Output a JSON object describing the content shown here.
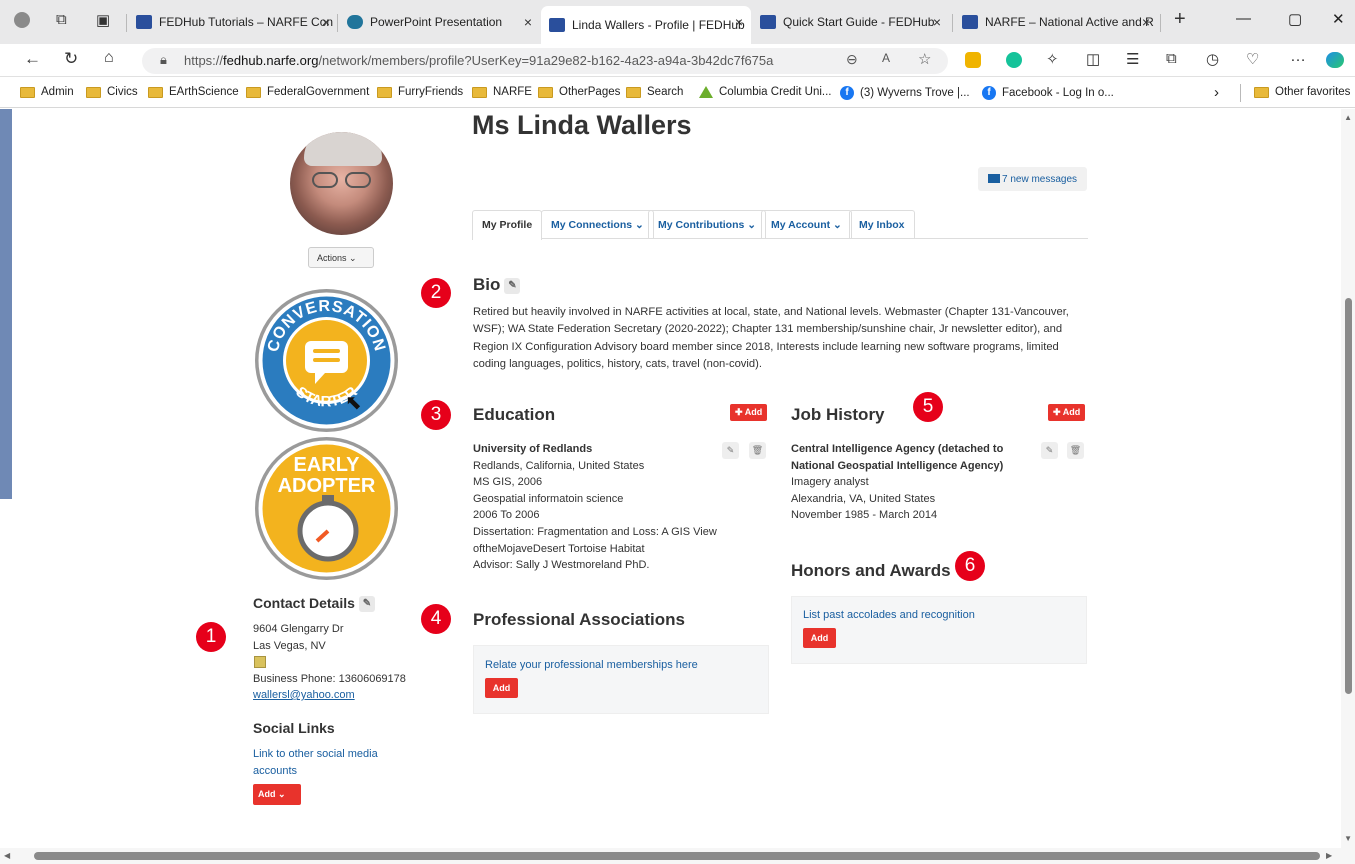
{
  "browser": {
    "tabs": [
      {
        "title": "FEDHub Tutorials – NARFE Con",
        "close": "×"
      },
      {
        "title": "PowerPoint Presentation",
        "close": "×"
      },
      {
        "title": "Linda Wallers - Profile | FEDHub",
        "close": "×"
      },
      {
        "title": "Quick Start Guide - FEDHub",
        "close": "×"
      },
      {
        "title": "NARFE – National Active and R",
        "close": "×"
      }
    ],
    "new_tab": "+",
    "window_controls": {
      "minimize": "—",
      "maximize": "▢",
      "close": "✕"
    },
    "url_prefix": "https://",
    "url_host": "fedhub.narfe.org",
    "url_path": "/network/members/profile?UserKey=91a29e82-b162-4a23-a94a-3b42dc7f675a",
    "bookmarks": [
      "Admin",
      "Civics",
      "EArthScience",
      "FederalGovernment",
      "FurryFriends",
      "NARFE",
      "OtherPages",
      "Search",
      "Columbia Credit Uni...",
      "(3) Wyverns Trove |...",
      "Facebook - Log In o...",
      "Other favorites"
    ],
    "bookmarks_more": "›"
  },
  "profile": {
    "name": "Ms Linda Wallers",
    "messages": "7 new messages",
    "actions": "Actions",
    "tabs": [
      "My Profile",
      "My Connections",
      "My Contributions",
      "My Account",
      "My Inbox"
    ],
    "badges": {
      "conversation_top": "CONVERSATION",
      "conversation_bottom": "STARTER",
      "early_line1": "EARLY",
      "early_line2": "ADOPTER"
    }
  },
  "bio": {
    "heading": "Bio",
    "text": "Retired but heavily involved in NARFE activities at local, state, and National levels. Webmaster (Chapter 131-Vancouver, WSF); WA State Federation Secretary (2020-2022); Chapter 131 membership/sunshine chair, Jr newsletter editor), and Region IX Configuration Advisory board member since 2018, Interests include learning new software programs, limited coding languages, politics, history, cats, travel (non-covid)."
  },
  "education": {
    "heading": "Education",
    "add": "Add",
    "school": "University of Redlands",
    "lines": [
      "Redlands, California, United States",
      "MS GIS, 2006",
      "Geospatial informatoin science",
      "2006 To 2006",
      "Dissertation: Fragmentation and Loss: A GIS View",
      "oftheMojaveDesert Tortoise Habitat",
      "Advisor: Sally J Westmoreland PhD."
    ]
  },
  "job_history": {
    "heading": "Job History",
    "add": "Add",
    "employer_line1": "Central Intelligence Agency (detached to",
    "employer_line2": "National Geospatial Intelligence Agency)",
    "lines": [
      "Imagery analyst",
      "Alexandria, VA, United States",
      "November 1985 - March 2014"
    ]
  },
  "honors": {
    "heading": "Honors and Awards",
    "prompt": "List past accolades and recognition",
    "add": "Add"
  },
  "associations": {
    "heading": "Professional Associations",
    "prompt": "Relate your professional memberships here",
    "add": "Add"
  },
  "contact": {
    "heading": "Contact Details",
    "address1": "9604 Glengarry Dr",
    "address2": "Las Vegas, NV",
    "phone": "Business Phone: 13606069178",
    "email": "wallersl@yahoo.com"
  },
  "social": {
    "heading": "Social Links",
    "link_line1": "Link to other social media",
    "link_line2": "accounts",
    "add": "Add"
  },
  "annotations": [
    "1",
    "2",
    "3",
    "4",
    "5",
    "6"
  ],
  "colors": {
    "accent": "#e8332c",
    "link": "#1a5fa0",
    "marker": "#e6001a"
  }
}
